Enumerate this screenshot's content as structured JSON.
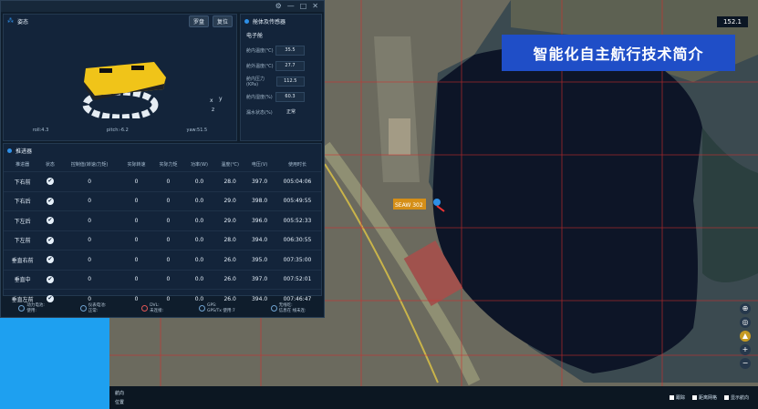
{
  "window": {
    "controls": [
      "⚙",
      "—",
      "□",
      "✕"
    ]
  },
  "attitude": {
    "title": "姿态",
    "buttons": [
      "罗盘",
      "复位"
    ],
    "roll": "roll:4.3",
    "pitch": "pitch:-6.2",
    "yaw": "yaw:51.5",
    "axes": [
      "x",
      "y",
      "z"
    ]
  },
  "sensors": {
    "title": "舱体及传感器",
    "section": "电子舱",
    "rows": [
      {
        "label": "舱内温度(℃)",
        "value": "35.5"
      },
      {
        "label": "舱外温度(℃)",
        "value": "27.7"
      },
      {
        "label": "舱内压力(KPa)",
        "value": "112.5"
      },
      {
        "label": "舱内湿度(%)",
        "value": "60.3"
      },
      {
        "label": "漏水状态(%)",
        "value": "正常"
      }
    ]
  },
  "thrusters": {
    "title": "推进器",
    "headers": [
      "推进器",
      "状态",
      "控制值(转速/力矩)",
      "实际转速",
      "实际力矩",
      "功率(W)",
      "温度(℃)",
      "电压(V)",
      "使用时长"
    ],
    "rows": [
      [
        "下右前",
        "0",
        "0",
        "0",
        "0.0",
        "28.0",
        "397.0",
        "005:04:06"
      ],
      [
        "下右后",
        "0",
        "0",
        "0",
        "0.0",
        "29.0",
        "398.0",
        "005:49:55"
      ],
      [
        "下左后",
        "0",
        "0",
        "0",
        "0.0",
        "29.0",
        "396.0",
        "005:52:33"
      ],
      [
        "下左前",
        "0",
        "0",
        "0",
        "0.0",
        "28.0",
        "394.0",
        "006:30:55"
      ],
      [
        "垂直右前",
        "0",
        "0",
        "0",
        "0.0",
        "26.0",
        "395.0",
        "007:35:00"
      ],
      [
        "垂直中",
        "0",
        "0",
        "0",
        "0.0",
        "26.0",
        "397.0",
        "007:52:01"
      ],
      [
        "垂直左前",
        "0",
        "0",
        "0",
        "0.0",
        "26.0",
        "394.0",
        "007:46:47"
      ]
    ],
    "check": "✔"
  },
  "statusbar": [
    {
      "icon": "battery-icon",
      "l1": "动力电池:",
      "l2": "使用:"
    },
    {
      "icon": "battery-icon",
      "l1": "仪表电池:",
      "l2": "正常:"
    },
    {
      "icon": "dvl-icon",
      "l1": "DVL:",
      "l2": "未连接:"
    },
    {
      "icon": "gps-icon",
      "l1": "GPS:",
      "l2": "GPS/Tx 使用:7"
    },
    {
      "icon": "comm-icon",
      "l1": "无线吃:",
      "l2": "信息在 线未连:"
    }
  ],
  "map": {
    "banner": "智能化自主航行技术简介",
    "scale": "152.1",
    "vessel_label": "SEAW 302",
    "bottom_left": [
      "航向",
      "位置"
    ],
    "legend": [
      "跟踪",
      "距离网格",
      "显示航向"
    ],
    "tools": [
      "⊕",
      "◎",
      "▲",
      "+",
      "−"
    ]
  }
}
